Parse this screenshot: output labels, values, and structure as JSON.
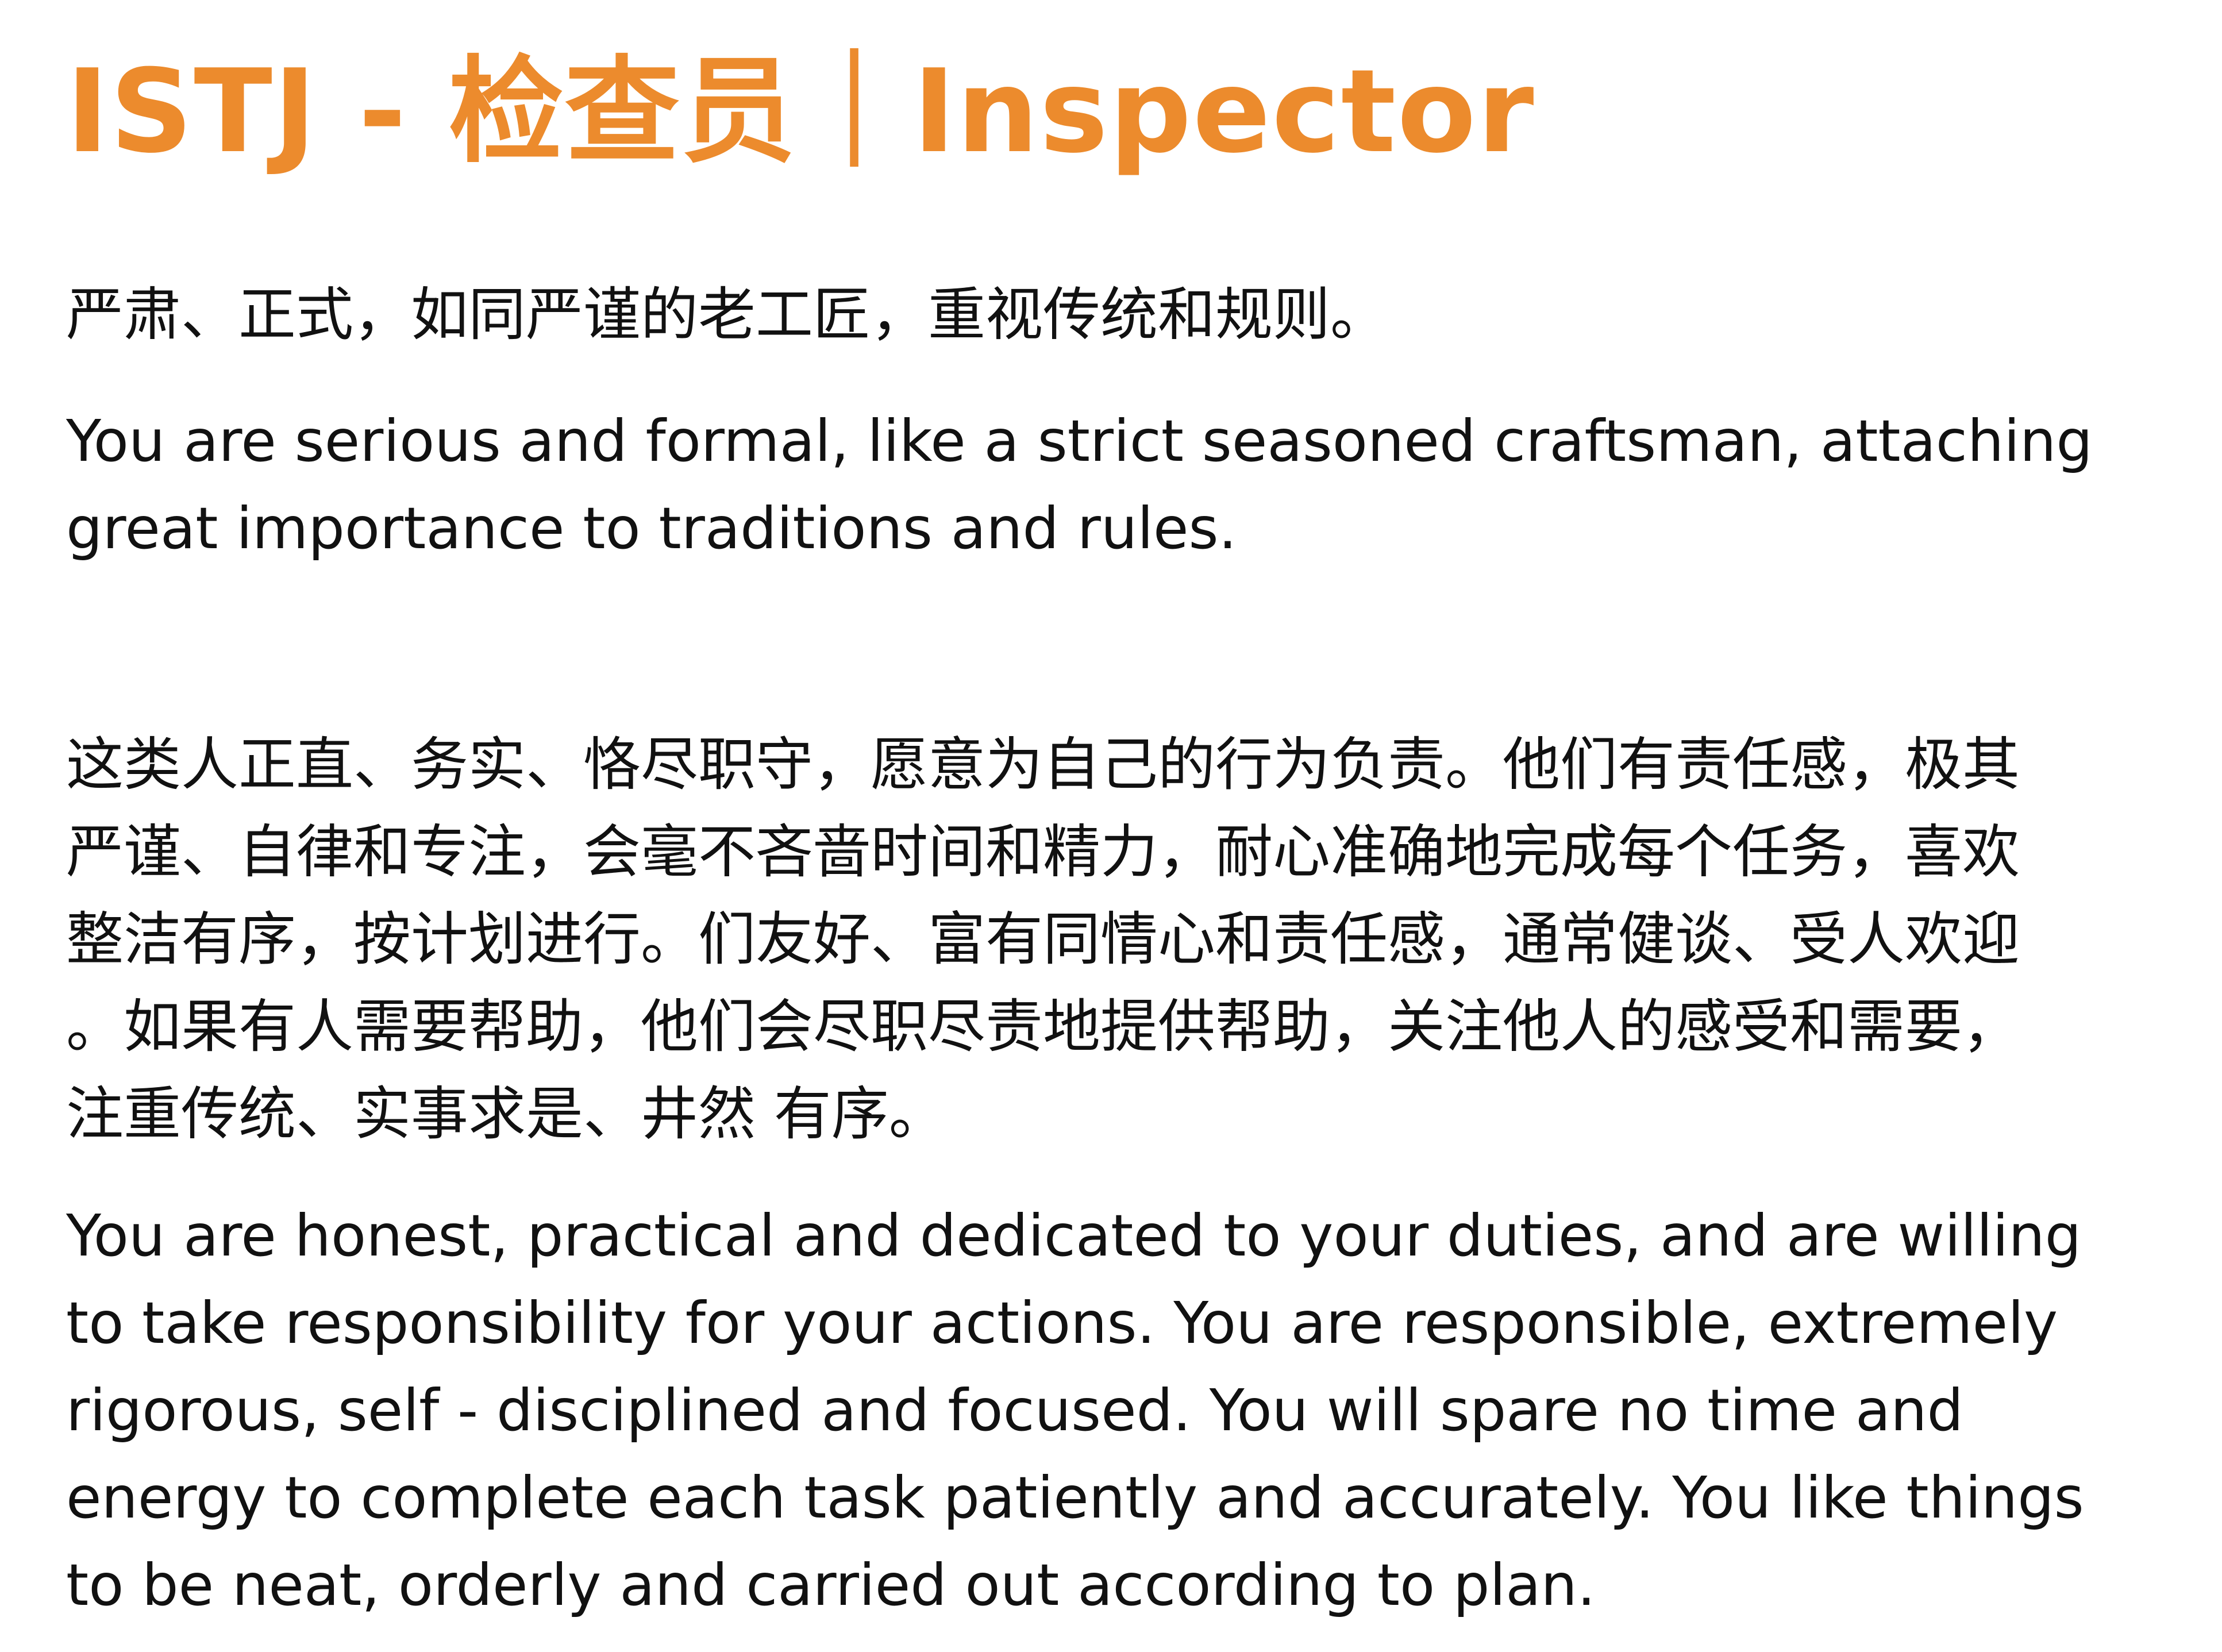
{
  "title": "ISTJ - 检查员｜Inspector",
  "colors": {
    "title": "#ec8b2d",
    "body_text": "#111111",
    "background": "#ffffff"
  },
  "intro_cn": {
    "lines": [
      "严肃、正式，如同严谨的老工匠，重视传统和规则。"
    ]
  },
  "intro_en": {
    "lines": [
      "You are serious and formal, like a strict seasoned craftsman, attaching",
      "great importance to traditions and rules."
    ]
  },
  "desc_cn": {
    "lines": [
      "这类人正直、务实、恪尽职守，愿意为自己的行为负责。他们有责任感，极其",
      "严谨、自律和专注，会毫不吝啬时间和精力，耐心准确地完成每个任务，喜欢",
      "整洁有序，按计划进行。们友好、富有同情心和责任感，通常健谈、受人欢迎",
      "。如果有人需要帮助，他们会尽职尽责地提供帮助，关注他人的感受和需要，",
      "注重传统、实事求是、井然 有序。"
    ]
  },
  "desc_en": {
    "lines": [
      "You are honest, practical and dedicated to your duties, and are willing",
      "to take responsibility for your actions. You are responsible, extremely",
      "rigorous, self - disciplined and focused. You will spare no time and",
      "energy to complete each task patiently and accurately. You like things",
      "to be neat, orderly and carried out according to plan."
    ]
  }
}
